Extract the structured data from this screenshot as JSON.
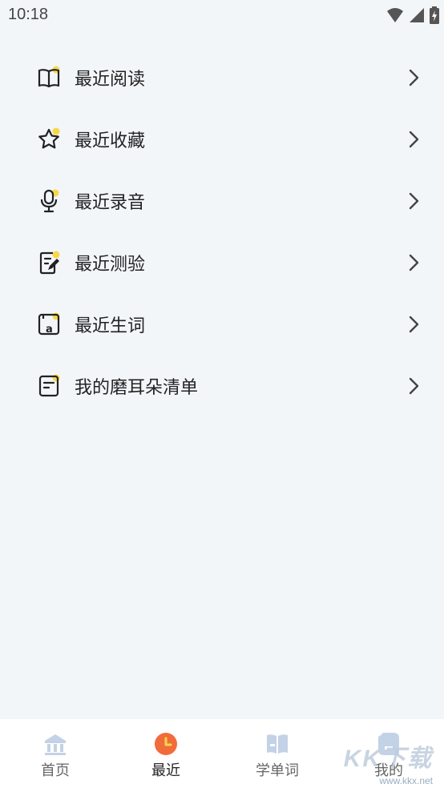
{
  "status_bar": {
    "time": "10:18"
  },
  "menu": {
    "items": [
      {
        "label": "最近阅读",
        "icon": "book-icon"
      },
      {
        "label": "最近收藏",
        "icon": "star-icon"
      },
      {
        "label": "最近录音",
        "icon": "microphone-icon"
      },
      {
        "label": "最近测验",
        "icon": "quiz-edit-icon"
      },
      {
        "label": "最近生词",
        "icon": "vocabulary-icon"
      },
      {
        "label": "我的磨耳朵清单",
        "icon": "playlist-icon"
      }
    ]
  },
  "tabbar": {
    "tabs": [
      {
        "label": "首页",
        "icon": "home-icon",
        "active": false
      },
      {
        "label": "最近",
        "icon": "clock-icon",
        "active": true
      },
      {
        "label": "学单词",
        "icon": "word-book-icon",
        "active": false
      },
      {
        "label": "我的",
        "icon": "profile-icon",
        "active": false
      }
    ]
  },
  "watermark": {
    "text": "KK下载",
    "url": "www.kkx.net"
  },
  "colors": {
    "accent_yellow": "#f7d84a",
    "active_tab": "#f26b3a",
    "inactive_tab": "#c3d2e6",
    "background": "#f3f6f9"
  }
}
